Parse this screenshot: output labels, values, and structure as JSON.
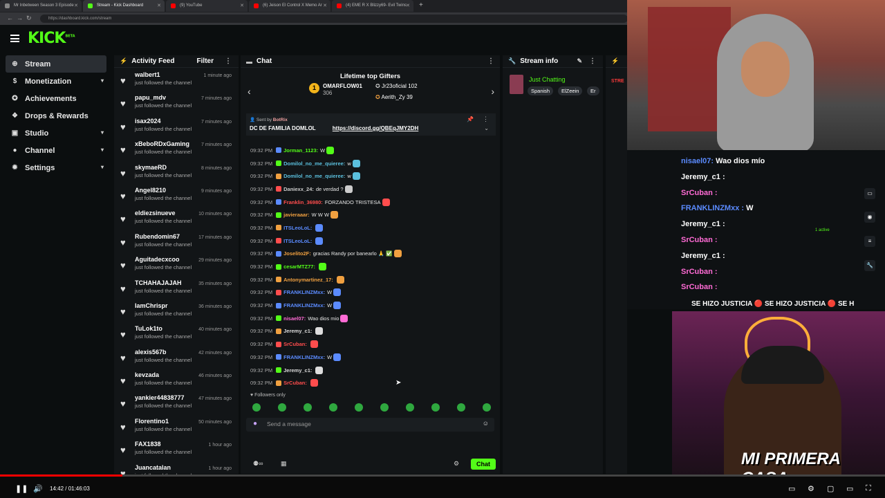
{
  "browser": {
    "tabs": [
      {
        "label": "Mr Inbetween Season 3 Episode",
        "color": "#888"
      },
      {
        "label": "Stream - Kick Dashboard",
        "color": "#53fc18"
      },
      {
        "label": "(9) YouTube",
        "color": "#ff0000"
      },
      {
        "label": "(6) Jeison El Control X Memo Ar",
        "color": "#ff0000"
      },
      {
        "label": "(4) EME R X Blizzy69- Evil Twins",
        "color": "#ff0000"
      }
    ],
    "url": "https://dashboard.kick.com/stream"
  },
  "logo": {
    "text": "KICK",
    "beta": "BETA"
  },
  "sidebar": {
    "items": [
      {
        "label": "Stream",
        "icon": "stream-icon",
        "glyph": "⊕",
        "chev": ""
      },
      {
        "label": "Monetization",
        "icon": "dollar-icon",
        "glyph": "$",
        "chev": "▾"
      },
      {
        "label": "Achievements",
        "icon": "award-icon",
        "glyph": "✪",
        "chev": ""
      },
      {
        "label": "Drops & Rewards",
        "icon": "gift-icon",
        "glyph": "❖",
        "chev": ""
      },
      {
        "label": "Studio",
        "icon": "studio-icon",
        "glyph": "▣",
        "chev": "▾"
      },
      {
        "label": "Channel",
        "icon": "user-icon",
        "glyph": "●",
        "chev": "▾"
      },
      {
        "label": "Settings",
        "icon": "gear-icon",
        "glyph": "✹",
        "chev": "▾"
      }
    ]
  },
  "activity": {
    "title": "Activity Feed",
    "filter": "Filter",
    "items": [
      {
        "name": "walbert1",
        "sub": "just followed the channel",
        "time": "1 minute ago"
      },
      {
        "name": "papu_mdv",
        "sub": "just followed the channel",
        "time": "7 minutes ago"
      },
      {
        "name": "isax2024",
        "sub": "just followed the channel",
        "time": "7 minutes ago"
      },
      {
        "name": "xBeboRDxGaming",
        "sub": "just followed the channel",
        "time": "7 minutes ago"
      },
      {
        "name": "skymaeRD",
        "sub": "just followed the channel",
        "time": "8 minutes ago"
      },
      {
        "name": "Angel8210",
        "sub": "just followed the channel",
        "time": "9 minutes ago"
      },
      {
        "name": "eldiezsinueve",
        "sub": "just followed the channel",
        "time": "10 minutes ago"
      },
      {
        "name": "Rubendomin67",
        "sub": "just followed the channel",
        "time": "17 minutes ago"
      },
      {
        "name": "Aguitadecxcoo",
        "sub": "just followed the channel",
        "time": "29 minutes ago"
      },
      {
        "name": "TCHAHAJAJAH",
        "sub": "just followed the channel",
        "time": "35 minutes ago"
      },
      {
        "name": "IamChrispr",
        "sub": "just followed the channel",
        "time": "36 minutes ago"
      },
      {
        "name": "TuLok1to",
        "sub": "just followed the channel",
        "time": "40 minutes ago"
      },
      {
        "name": "alexis567b",
        "sub": "just followed the channel",
        "time": "42 minutes ago"
      },
      {
        "name": "kevzada",
        "sub": "just followed the channel",
        "time": "46 minutes ago"
      },
      {
        "name": "yankier44838777",
        "sub": "just followed the channel",
        "time": "47 minutes ago"
      },
      {
        "name": "Florentino1",
        "sub": "just followed the channel",
        "time": "50 minutes ago"
      },
      {
        "name": "FAX1838",
        "sub": "just followed the channel",
        "time": "1 hour ago"
      },
      {
        "name": "Juancatalan",
        "sub": "just followed the channel",
        "time": "1 hour ago"
      }
    ]
  },
  "chat": {
    "title": "Chat",
    "gifters_title": "Lifetime top Gifters",
    "gifters": [
      {
        "name": "OMARFLOW01",
        "count": "306"
      },
      {
        "name": "Jr23oficial",
        "count": "102"
      },
      {
        "name": "Aerith_Zy",
        "count": "39"
      }
    ],
    "pinned_by": "Sent by",
    "pinned_bot": "BotRix",
    "pinned_text": "DC DE FAMILIA DOMLOL",
    "pinned_link": "https://discord.gg/QBEqJMY2DH",
    "messages": [
      {
        "time": "09:32 PM",
        "user": "Jorman_1123:",
        "color": "#53fc18",
        "text": "W"
      },
      {
        "time": "09:32 PM",
        "user": "Domilol_no_me_quieree:",
        "color": "#5bc0de",
        "text": "w"
      },
      {
        "time": "09:32 PM",
        "user": "Domilol_no_me_quieree:",
        "color": "#5bc0de",
        "text": "w"
      },
      {
        "time": "09:32 PM",
        "user": "Daniexx_24:",
        "color": "#ccc",
        "text": "de verdad ?"
      },
      {
        "time": "09:32 PM",
        "user": "Franklin_36980:",
        "color": "#ff4d4d",
        "text": "FORZANDO TRISTESA"
      },
      {
        "time": "09:32 PM",
        "user": "javieraaar:",
        "color": "#f0a040",
        "text": "W W W"
      },
      {
        "time": "09:32 PM",
        "user": "ITSLeoLoL:",
        "color": "#5b8bff",
        "text": ""
      },
      {
        "time": "09:32 PM",
        "user": "ITSLeoLoL:",
        "color": "#5b8bff",
        "text": ""
      },
      {
        "time": "09:32 PM",
        "user": "Joselito2F:",
        "color": "#f0a040",
        "text": "gracias Randy por banearlo 🙏 ✅"
      },
      {
        "time": "09:32 PM",
        "user": "cesarMTZ77:",
        "color": "#53fc18",
        "text": ""
      },
      {
        "time": "09:32 PM",
        "user": "Antonymartinez_17:",
        "color": "#f0a040",
        "text": ""
      },
      {
        "time": "09:32 PM",
        "user": "FRANKLINZMxx:",
        "color": "#5b8bff",
        "text": "W"
      },
      {
        "time": "09:32 PM",
        "user": "FRANKLINZMxx:",
        "color": "#5b8bff",
        "text": "W"
      },
      {
        "time": "09:32 PM",
        "user": "nisael07:",
        "color": "#ff6bd5",
        "text": "Wao dios mio"
      },
      {
        "time": "09:32 PM",
        "user": "Jeremy_c1:",
        "color": "#ddd",
        "text": ""
      },
      {
        "time": "09:32 PM",
        "user": "SrCuban:",
        "color": "#ff4d4d",
        "text": ""
      },
      {
        "time": "09:32 PM",
        "user": "FRANKLINZMxx:",
        "color": "#5b8bff",
        "text": "W"
      },
      {
        "time": "09:32 PM",
        "user": "Jeremy_c1:",
        "color": "#ddd",
        "text": ""
      },
      {
        "time": "09:32 PM",
        "user": "SrCuban:",
        "color": "#ff4d4d",
        "text": ""
      }
    ],
    "followers_only": "♥ Followers only",
    "placeholder": "Send a message",
    "send_label": "Chat"
  },
  "stream_info": {
    "title": "Stream info",
    "category": "Just Chatting",
    "tags": [
      "Spanish",
      "ElZeein",
      "Er"
    ]
  },
  "overlay": {
    "right_chat": [
      {
        "user": "nisael07:",
        "text": "Wao dios mío",
        "color": "#5b8bff"
      },
      {
        "user": "Jeremy_c1 :",
        "text": "",
        "color": "#fff"
      },
      {
        "user": "SrCuban :",
        "text": "",
        "color": "#ff6bd5"
      },
      {
        "user": "FRANKLINZMxx :",
        "text": "W",
        "color": "#5b8bff"
      },
      {
        "user": "Jeremy_c1 :",
        "text": "",
        "color": "#fff"
      },
      {
        "user": "SrCuban :",
        "text": "",
        "color": "#ff6bd5"
      },
      {
        "user": "Jeremy_c1 :",
        "text": "",
        "color": "#fff"
      },
      {
        "user": "SrCuban :",
        "text": "",
        "color": "#ff6bd5"
      },
      {
        "user": "SrCuban :",
        "text": "",
        "color": "#ff6bd5"
      }
    ],
    "ticker": "SE HIZO JUSTICIA 🔴 SE HIZO JUSTICIA 🔴 SE H",
    "brand": "MI PRIMERA CASA",
    "stream_badge": "STRE",
    "active": "1 active"
  },
  "player": {
    "time": "14:42 / 01:46:03",
    "progress": 0.138
  }
}
